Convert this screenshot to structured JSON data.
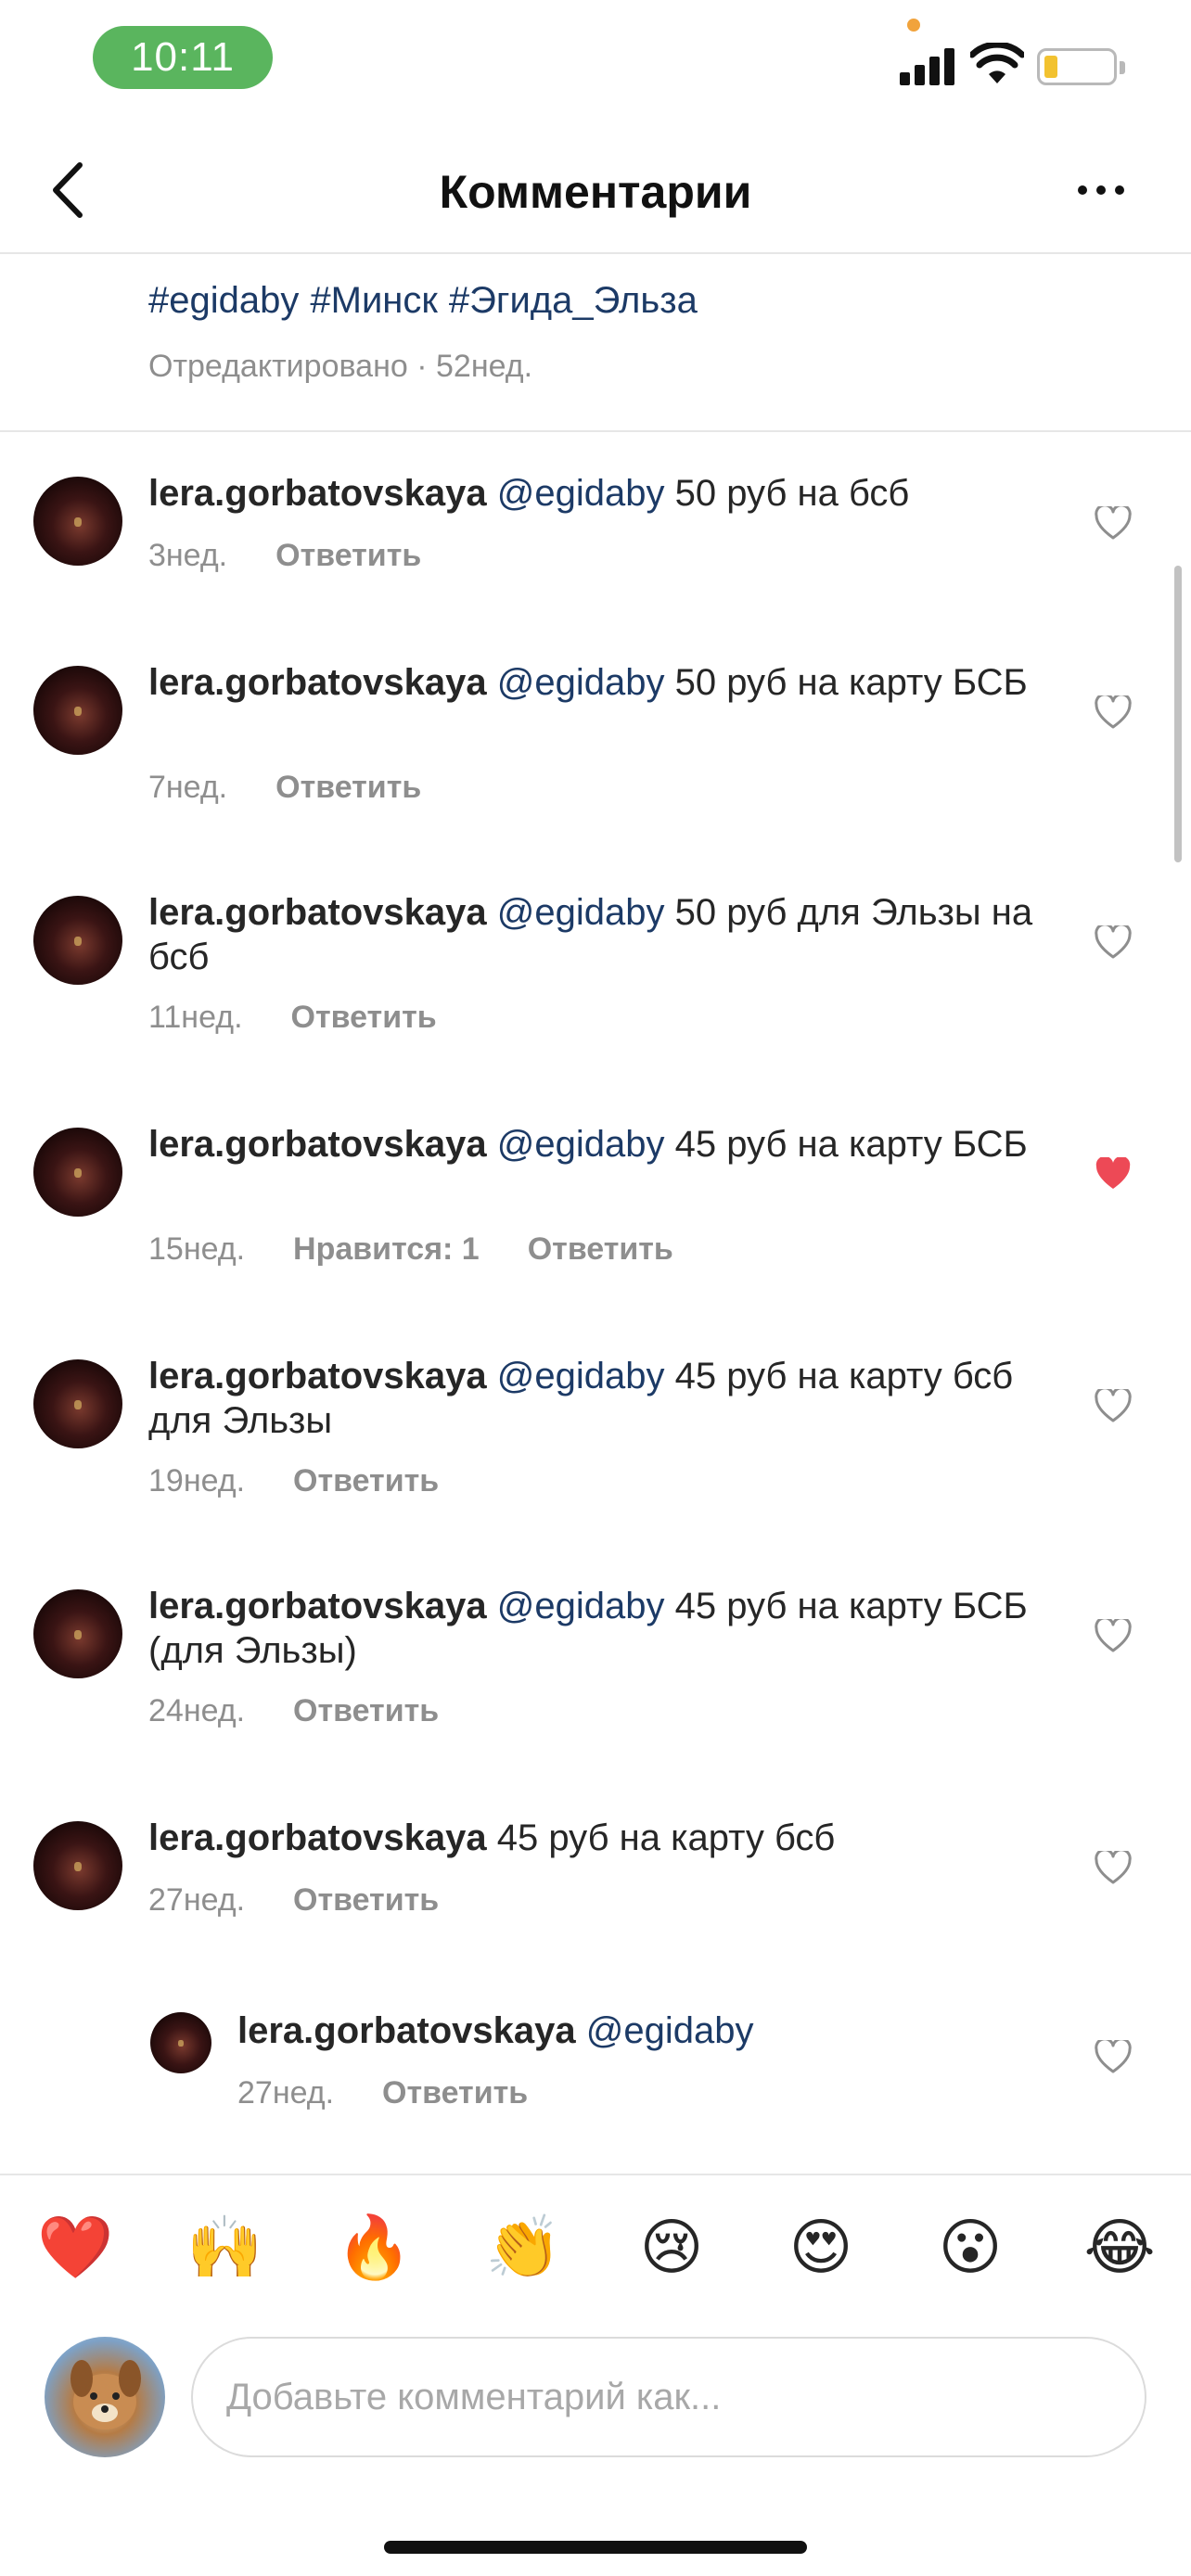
{
  "status_bar": {
    "time": "10:11",
    "colors": {
      "time_pill": "#5ab55e",
      "battery_fill": "#f2c230",
      "dot": "#f1a33c"
    }
  },
  "header": {
    "title": "Комментарии",
    "back_icon": "chevron-left-icon",
    "more_icon": "more-horizontal-icon"
  },
  "caption": {
    "hashtags": [
      "#egidaby",
      "#Минск",
      "#Эгида_Эльза"
    ],
    "edited_label": "Отредактировано",
    "separator": "·",
    "time": "52нед."
  },
  "comments": [
    {
      "username": "lera.gorbatovskaya",
      "mention": "@egidaby",
      "text": "50 руб на бсб",
      "time": "3нед.",
      "likes_label": "",
      "reply_label": "Ответить",
      "liked": false
    },
    {
      "username": "lera.gorbatovskaya",
      "mention": "@egidaby",
      "text": "50 руб на карту БСБ",
      "time": "7нед.",
      "likes_label": "",
      "reply_label": "Ответить",
      "liked": false
    },
    {
      "username": "lera.gorbatovskaya",
      "mention": "@egidaby",
      "text": "50 руб для Эльзы на бсб",
      "time": "11нед.",
      "likes_label": "",
      "reply_label": "Ответить",
      "liked": false
    },
    {
      "username": "lera.gorbatovskaya",
      "mention": "@egidaby",
      "text": "45 руб на карту БСБ",
      "time": "15нед.",
      "likes_label": "Нравится: 1",
      "reply_label": "Ответить",
      "liked": true
    },
    {
      "username": "lera.gorbatovskaya",
      "mention": "@egidaby",
      "text": "45 руб на карту бсб для Эльзы",
      "time": "19нед.",
      "likes_label": "",
      "reply_label": "Ответить",
      "liked": false
    },
    {
      "username": "lera.gorbatovskaya",
      "mention": "@egidaby",
      "text": "45 руб на карту БСБ (для Эльзы)",
      "time": "24нед.",
      "likes_label": "",
      "reply_label": "Ответить",
      "liked": false
    },
    {
      "username": "lera.gorbatovskaya",
      "mention": "",
      "text": "45 руб на карту бсб",
      "time": "27нед.",
      "likes_label": "",
      "reply_label": "Ответить",
      "liked": false
    }
  ],
  "reply": {
    "username": "lera.gorbatovskaya",
    "mention": "@egidaby",
    "text": "",
    "time": "27нед.",
    "likes_label": "",
    "reply_label": "Ответить",
    "liked": false
  },
  "emoji_bar": [
    "❤️",
    "🙌",
    "🔥",
    "👏",
    "😢",
    "😍",
    "😮",
    "😂"
  ],
  "composer": {
    "placeholder": "Добавьте комментарий как..."
  },
  "colors": {
    "mention": "#1c3a66",
    "meta": "#8e8e8e",
    "liked_heart": "#ed4956",
    "heart_outline": "#8e8e8e"
  }
}
